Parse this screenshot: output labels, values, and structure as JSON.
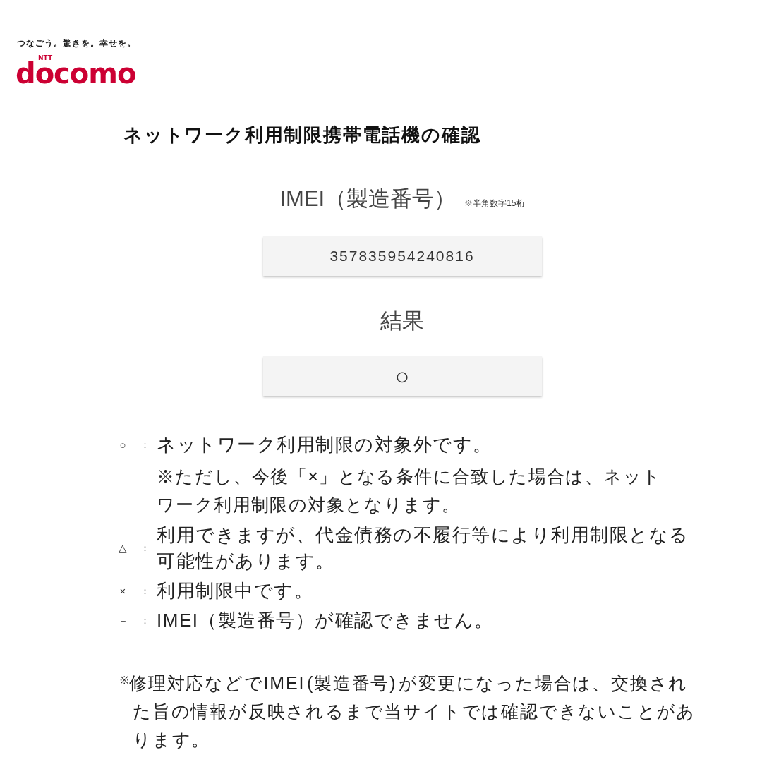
{
  "header": {
    "tagline": "つなごう。驚きを。幸せを。",
    "logo": {
      "mark": "NTT",
      "name": "docomo"
    }
  },
  "title": "ネットワーク利用制限携帯電話機の確認",
  "imei": {
    "label": "IMEI（製造番号）",
    "hint": "※半角数字15桁",
    "value": "357835954240816"
  },
  "result": {
    "label": "結果",
    "value": "○"
  },
  "legend": [
    {
      "symbol": "○",
      "separator": "：",
      "text": "ネットワーク利用制限の対象外です。",
      "note": "※ただし、今後「×」となる条件に合致した場合は、ネットワーク利用制限の対象となります。"
    },
    {
      "symbol": "△",
      "separator": "：",
      "text": "利用できますが、代金債務の不履行等により利用制限となる可能性があります。"
    },
    {
      "symbol": "×",
      "separator": "：",
      "text": "利用制限中です。"
    },
    {
      "symbol": "－",
      "separator": "：",
      "text": "IMEI（製造番号）が確認できません。"
    }
  ],
  "footnote": "$^{※}$修理対応などでIMEI (製造番号) が変更になった場合は、交換された旨の情報が反映されるまで当サイトでは確認できないことがあります。"
}
